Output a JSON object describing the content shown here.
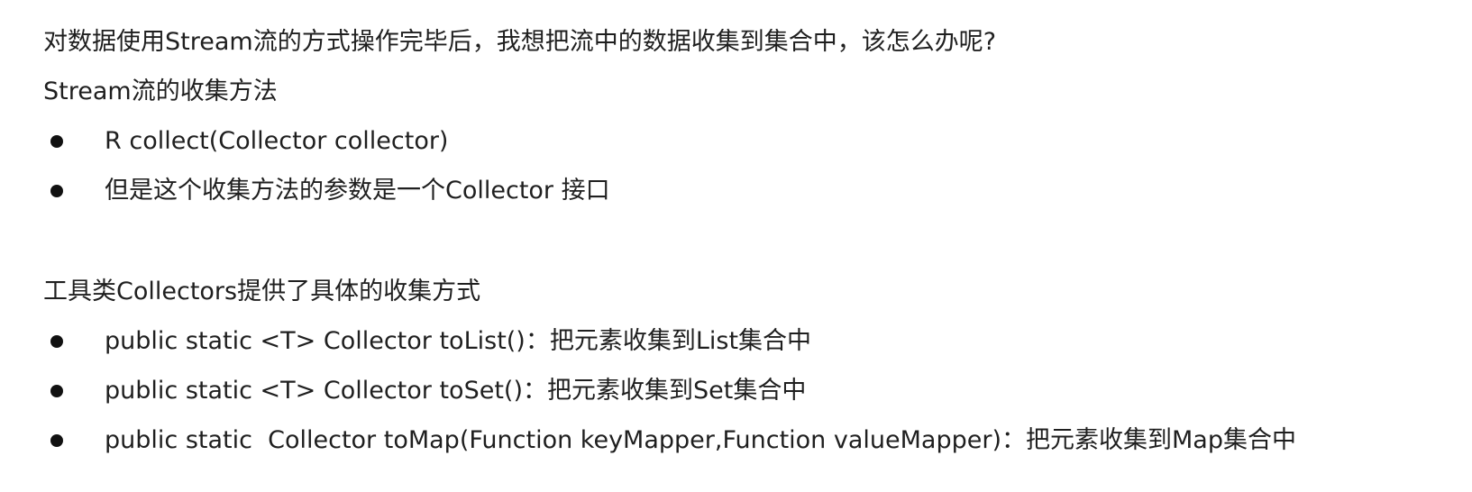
{
  "intro": {
    "question": "对数据使用Stream流的方式操作完毕后，我想把流中的数据收集到集合中，该怎么办呢?",
    "heading": "Stream流的收集方法"
  },
  "collect_bullets": [
    "R collect(Collector collector)",
    "但是这个收集方法的参数是一个Collector 接口"
  ],
  "tools": {
    "heading": "工具类Collectors提供了具体的收集方式"
  },
  "tool_bullets": [
    "public static <T> Collector toList()：把元素收集到List集合中",
    "public static <T> Collector toSet()：把元素收集到Set集合中",
    "public static  Collector toMap(Function keyMapper,Function valueMapper)：把元素收集到Map集合中"
  ]
}
